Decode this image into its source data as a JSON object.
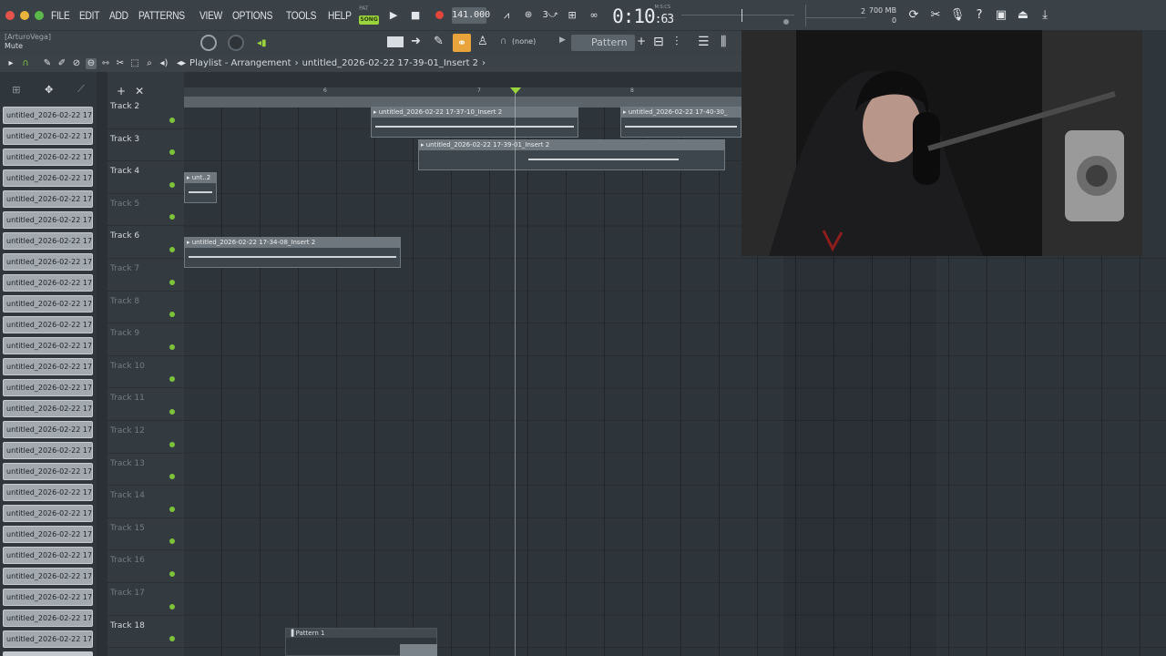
{
  "menu": [
    "FILE",
    "EDIT",
    "ADD",
    "PATTERNS",
    "VIEW",
    "OPTIONS",
    "TOOLS",
    "HELP"
  ],
  "transport": {
    "pat_label": "PAT",
    "song_label": "SONG",
    "tempo": "141.000",
    "time_main": "0:10",
    "time_small": ":63",
    "time_format": "M:S:CS",
    "memory": "700 MB",
    "memory_sub": "0",
    "counter": "2"
  },
  "hint": {
    "user": "[ArturoVega]",
    "text": "Mute"
  },
  "toolbar2": {
    "none_label": "(none)",
    "pattern": "Pattern 1"
  },
  "playlist": {
    "title": "Playlist - Arrangement",
    "crumb_clip": "untitled_2026-02-22 17-39-01_Insert 2",
    "crumb_sep": "›"
  },
  "browser": {
    "clip_label": "untitled_2026-02-22 17-...",
    "clip_count": 27
  },
  "ruler": [
    "6",
    "7",
    "8"
  ],
  "tracks": [
    {
      "name": "Track 2",
      "dim": false
    },
    {
      "name": "Track 3",
      "dim": false
    },
    {
      "name": "Track 4",
      "dim": false
    },
    {
      "name": "Track 5",
      "dim": true
    },
    {
      "name": "Track 6",
      "dim": false
    },
    {
      "name": "Track 7",
      "dim": true
    },
    {
      "name": "Track 8",
      "dim": true
    },
    {
      "name": "Track 9",
      "dim": true
    },
    {
      "name": "Track 10",
      "dim": true
    },
    {
      "name": "Track 11",
      "dim": true
    },
    {
      "name": "Track 12",
      "dim": true
    },
    {
      "name": "Track 13",
      "dim": true
    },
    {
      "name": "Track 14",
      "dim": true
    },
    {
      "name": "Track 15",
      "dim": true
    },
    {
      "name": "Track 16",
      "dim": true
    },
    {
      "name": "Track 17",
      "dim": true
    },
    {
      "name": "Track 18",
      "dim": false
    }
  ],
  "clips": [
    {
      "label": "▸ untitled_2026-02-22 17-37-10_Insert 2"
    },
    {
      "label": "▸ untitled_2026-02-22 17-40-30_"
    },
    {
      "label": "▸ untitled_2026-02-22 17-39-01_Insert 2"
    },
    {
      "label": "▸ unt..2"
    },
    {
      "label": "▸ untitled_2026-02-22 17-34-08_Insert 2"
    }
  ],
  "pattern_clip": {
    "label": "▐ Pattern 1"
  },
  "colors": {
    "accent_green": "#9bd33c",
    "led_green": "#7cc23a",
    "record_red": "#e2453c"
  }
}
